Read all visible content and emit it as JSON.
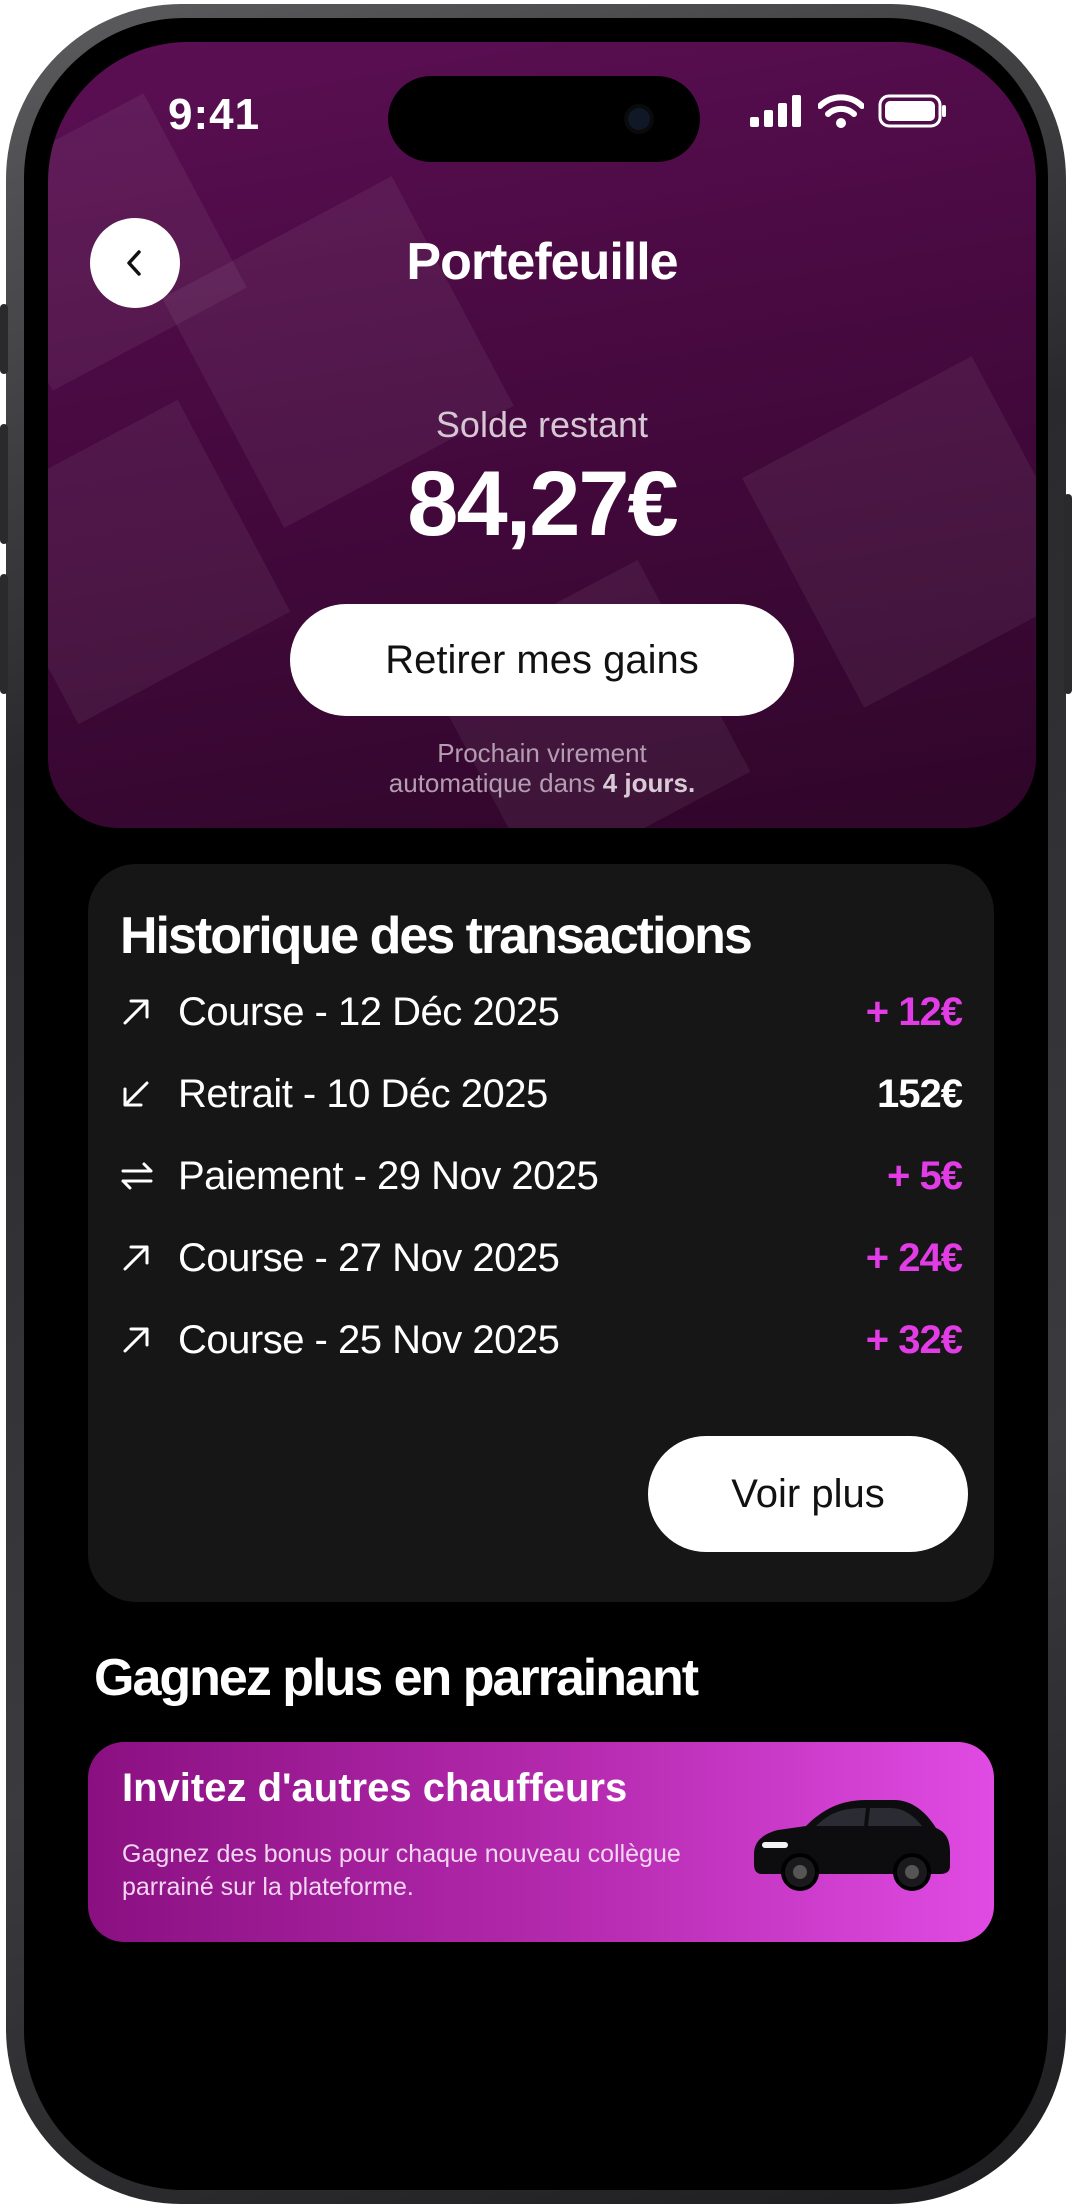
{
  "status_bar": {
    "time": "9:41"
  },
  "header": {
    "title": "Portefeuille"
  },
  "balance": {
    "label": "Solde restant",
    "amount": "84,27€",
    "withdraw_label": "Retirer mes gains",
    "next_transfer_prefix": "Prochain virement",
    "next_transfer_middle": "automatique dans",
    "next_transfer_bold": "4 jours."
  },
  "history": {
    "title": "Historique des transactions",
    "items": [
      {
        "icon": "arrow-up-right-icon",
        "label": "Course - 12 Déc 2025",
        "amount": "+ 12€",
        "color": "#e23ce6"
      },
      {
        "icon": "arrow-down-left-icon",
        "label": "Retrait - 10 Déc 2025",
        "amount": "152€",
        "color": "#ffffff"
      },
      {
        "icon": "swap-icon",
        "label": "Paiement - 29 Nov 2025",
        "amount": "+ 5€",
        "color": "#e23ce6"
      },
      {
        "icon": "arrow-up-right-icon",
        "label": "Course - 27 Nov 2025",
        "amount": "+ 24€",
        "color": "#e23ce6"
      },
      {
        "icon": "arrow-up-right-icon",
        "label": "Course - 25 Nov 2025",
        "amount": "+ 32€",
        "color": "#e23ce6"
      }
    ],
    "more_label": "Voir plus"
  },
  "referral": {
    "section_title": "Gagnez plus en parrainant",
    "card_title": "Invitez d'autres chauffeurs",
    "card_text": "Gagnez des bonus pour chaque nouveau collègue parrainé sur la plateforme."
  },
  "colors": {
    "accent": "#e23ce6",
    "header_bg": "#4a0a43",
    "card_bg": "#161616"
  }
}
